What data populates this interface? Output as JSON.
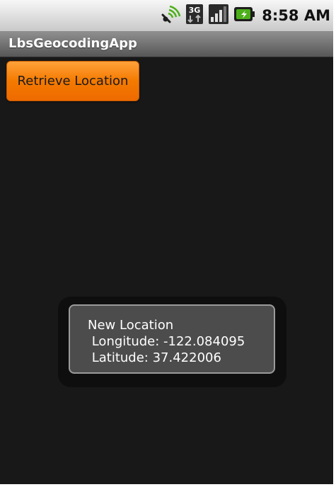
{
  "status_bar": {
    "time": "8:58 AM",
    "icons": [
      "gps-signal-icon",
      "3g-data-icon",
      "cell-signal-icon",
      "battery-charging-icon"
    ]
  },
  "app": {
    "title": "LbsGeocodingApp"
  },
  "main": {
    "retrieve_button_label": "Retrieve Location"
  },
  "toast": {
    "heading": "New Location",
    "longitude_line": " Longitude: -122.084095",
    "latitude_line": " Latitude: 37.422006"
  },
  "colors": {
    "button_orange": "#f47a00",
    "background": "#181818",
    "toast_bg": "#4c4c4c"
  }
}
